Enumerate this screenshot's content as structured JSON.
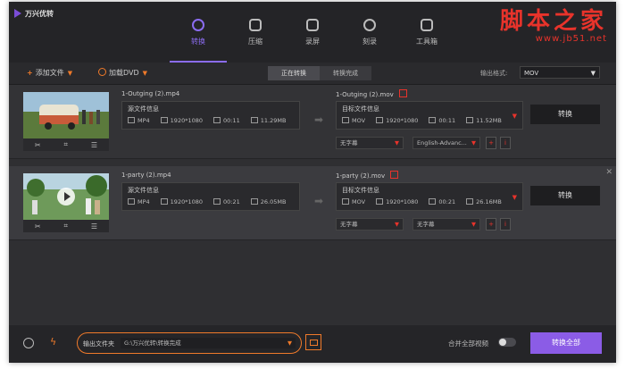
{
  "app": {
    "name": "万兴优转"
  },
  "watermark": {
    "title": "脚本之家",
    "url": "www.jb51.net"
  },
  "nav": [
    {
      "label": "转换",
      "icon": "convert-icon",
      "active": true
    },
    {
      "label": "压缩",
      "icon": "compress-icon",
      "active": false
    },
    {
      "label": "录屏",
      "icon": "record-screen-icon",
      "active": false
    },
    {
      "label": "刻录",
      "icon": "burn-disc-icon",
      "active": false
    },
    {
      "label": "工具箱",
      "icon": "toolbox-icon",
      "active": false
    }
  ],
  "toolbar": {
    "add_file": "添加文件",
    "load_dvd": "加载DVD",
    "tab_converting": "正在转换",
    "tab_done": "转换完成",
    "output_format_label": "输出格式:",
    "output_format_value": "MOV"
  },
  "files": [
    {
      "source_name": "1-Outging (2).mp4",
      "source_title": "源文件信息",
      "source": {
        "format": "MP4",
        "resolution": "1920*1080",
        "duration": "00:11",
        "size": "11.29MB"
      },
      "target_name": "1-Outging (2).mov",
      "target_title": "目标文件信息",
      "target": {
        "format": "MOV",
        "resolution": "1920*1080",
        "duration": "00:11",
        "size": "11.52MB"
      },
      "subtitle": "无字幕",
      "audio": "English-Advanc...",
      "convert": "转换"
    },
    {
      "source_name": "1-party (2).mp4",
      "source_title": "源文件信息",
      "source": {
        "format": "MP4",
        "resolution": "1920*1080",
        "duration": "00:21",
        "size": "26.05MB"
      },
      "target_name": "1-party (2).mov",
      "target_title": "目标文件信息",
      "target": {
        "format": "MOV",
        "resolution": "1920*1080",
        "duration": "00:21",
        "size": "26.16MB"
      },
      "subtitle": "无字幕",
      "audio": "无字幕",
      "convert": "转换"
    }
  ],
  "bottom": {
    "output_folder_label": "输出文件夹",
    "output_path": "G:\\万兴优转\\转换完成",
    "merge_label": "合并全部视频",
    "convert_all": "转换全部"
  },
  "colors": {
    "accent": "#8b5ce6",
    "highlight": "#f07a2a",
    "watermark": "#e8332b"
  }
}
